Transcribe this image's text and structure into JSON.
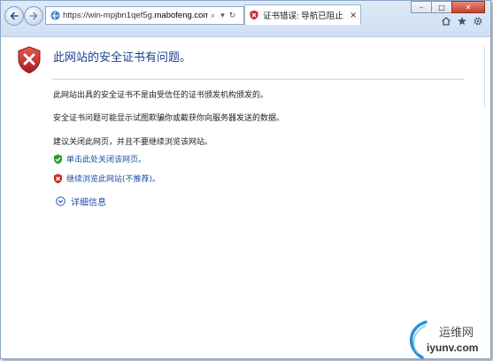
{
  "toolbar": {
    "url_prefix": "https://win-mpjbn1qef5g.",
    "url_domain": "mabofeng.com",
    "search_glyph": "⌕",
    "dropdown_glyph": "▾",
    "refresh_glyph": "↻"
  },
  "tab": {
    "title": "证书错误: 导航已阻止",
    "close_glyph": "×"
  },
  "window_controls": {
    "minimize": "–",
    "maximize": "□",
    "close": "✕"
  },
  "page": {
    "heading": "此网站的安全证书有问题。",
    "para1": "此网站出具的安全证书不是由受信任的证书颁发机构颁发的。",
    "para2": "安全证书问题可能显示试图欺骗你或截获你向服务器发送的数据。",
    "para3": "建议关闭此网页，并且不要继续浏览该网站。",
    "close_link": "单击此处关闭该网页。",
    "continue_link": "继续浏览此网站(不推荐)。",
    "details_link": "详细信息"
  },
  "watermark": {
    "cn": "运维网",
    "en": "iyunv.com"
  },
  "colors": {
    "link": "#1a4fa3",
    "heading": "#1d3f8f",
    "danger": "#c8282a",
    "ok": "#2e9a2e"
  }
}
